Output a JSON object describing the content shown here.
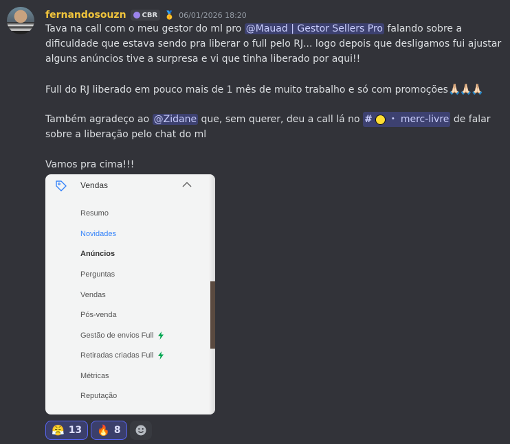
{
  "message": {
    "username": "fernandosouzn",
    "tag": "CBR",
    "timestamp": "06/01/2026 18:20",
    "lines": {
      "l1a": "Tava na call com o meu gestor do ml pro ",
      "mention1": "@Mauad | Gestor Sellers Pro",
      "l1b": " falando sobre a",
      "l2": "dificuldade que estava sendo pra liberar o full pelo RJ... logo depois que desligamos fui ajustar",
      "l3": "alguns anúncios tive a surpresa e vi que tinha liberado por aqui!!",
      "l4": "Full do RJ liberado em pouco mais de 1 mês de muito trabalho e só com promoções",
      "l4_emoji": "🙏🏻🙏🏻🙏🏻",
      "l5a": "Também agradeço ao ",
      "mention2": "@Zidane",
      "l5b": " que, sem querer, deu a call lá no ",
      "channel_hash": "#",
      "channel_sep": "・",
      "channel_name": "merc-livre",
      "l5c": " de falar",
      "l6": "sobre a liberação pelo chat do ml",
      "l7": "Vamos pra cima!!!"
    }
  },
  "attachment": {
    "title": "Vendas",
    "items": [
      {
        "label": "Resumo"
      },
      {
        "label": "Novidades"
      },
      {
        "label": "Anúncios"
      },
      {
        "label": "Perguntas"
      },
      {
        "label": "Vendas"
      },
      {
        "label": "Pós-venda"
      },
      {
        "label": "Gestão de envios Full"
      },
      {
        "label": "Retiradas criadas Full"
      },
      {
        "label": "Métricas"
      },
      {
        "label": "Reputação"
      }
    ],
    "accent_color": "#3483fa",
    "bolt_color": "#00a650"
  },
  "reactions": [
    {
      "emoji": "😤",
      "icon": "steam-face-emoji",
      "count": "13"
    },
    {
      "emoji": "🔥",
      "icon": "fire-emoji",
      "count": "8"
    }
  ],
  "colors": {
    "background": "#323339",
    "username": "#f0c43c",
    "mention_bg": "#3c4270"
  }
}
